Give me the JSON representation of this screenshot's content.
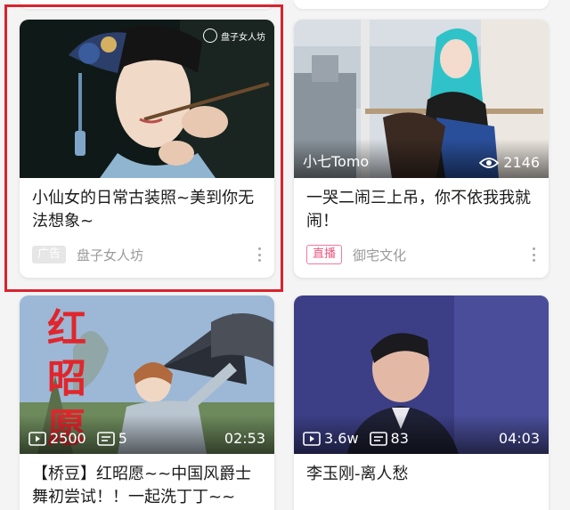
{
  "cards": [
    {
      "title": "小仙女的日常古装照~美到你无法想象~",
      "badge": "广告",
      "uploader": "盘子女人坊",
      "logo_text": "盘子女人坊"
    },
    {
      "title": "一哭二闹三上吊，你不依我我就闹！",
      "badge": "直播",
      "uploader": "御宅文化",
      "overlay_name": "小七Tomo",
      "views": "2146"
    },
    {
      "title": "【桥豆】红昭愿~~中国风爵士舞初尝试！！一起洗丁丁~~",
      "plays": "2500",
      "danmaku": "5",
      "duration": "02:53",
      "vertical_text": "红昭愿"
    },
    {
      "title": "李玉刚-离人愁",
      "plays": "3.6w",
      "danmaku": "83",
      "duration": "04:03"
    }
  ],
  "colors": {
    "highlight": "#d9232e",
    "live_badge": "#f0557f",
    "ad_badge": "#e6e6e6"
  },
  "icons": [
    "eye-icon",
    "play-icon",
    "danmaku-icon",
    "more-icon"
  ]
}
